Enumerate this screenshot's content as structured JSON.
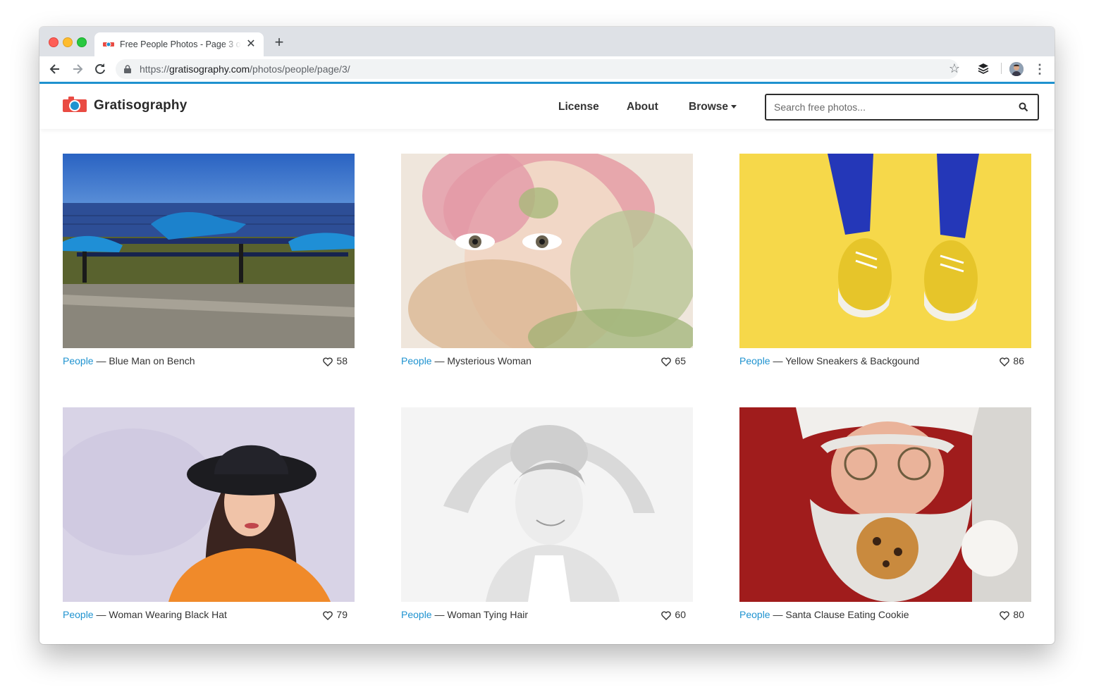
{
  "browser": {
    "tab_title": "Free People Photos - Page 3 of",
    "tab_close": "✕",
    "new_tab": "+",
    "url_scheme": "https://",
    "url_host": "gratisography.com",
    "url_path": "/photos/people/page/3/",
    "star_glyph": "☆",
    "menu_glyph": "⋮"
  },
  "site": {
    "brand": "Gratisography",
    "brand_colors": {
      "accent": "#1f93d0",
      "logo_red": "#e94b43",
      "logo_blue": "#1f93d0"
    },
    "nav": {
      "license": "License",
      "about": "About",
      "browse": "Browse"
    },
    "search_placeholder": "Search free photos..."
  },
  "photos": [
    {
      "category": "People",
      "sep": " — ",
      "title": "Blue Man on Bench",
      "likes": "58"
    },
    {
      "category": "People",
      "sep": " — ",
      "title": "Mysterious Woman",
      "likes": "65"
    },
    {
      "category": "People",
      "sep": " — ",
      "title": "Yellow Sneakers & Backgound",
      "likes": "86"
    },
    {
      "category": "People",
      "sep": " — ",
      "title": "Woman Wearing Black Hat",
      "likes": "79"
    },
    {
      "category": "People",
      "sep": " — ",
      "title": "Woman Tying Hair",
      "likes": "60"
    },
    {
      "category": "People",
      "sep": " — ",
      "title": "Santa Clause Eating Cookie",
      "likes": "80"
    }
  ]
}
